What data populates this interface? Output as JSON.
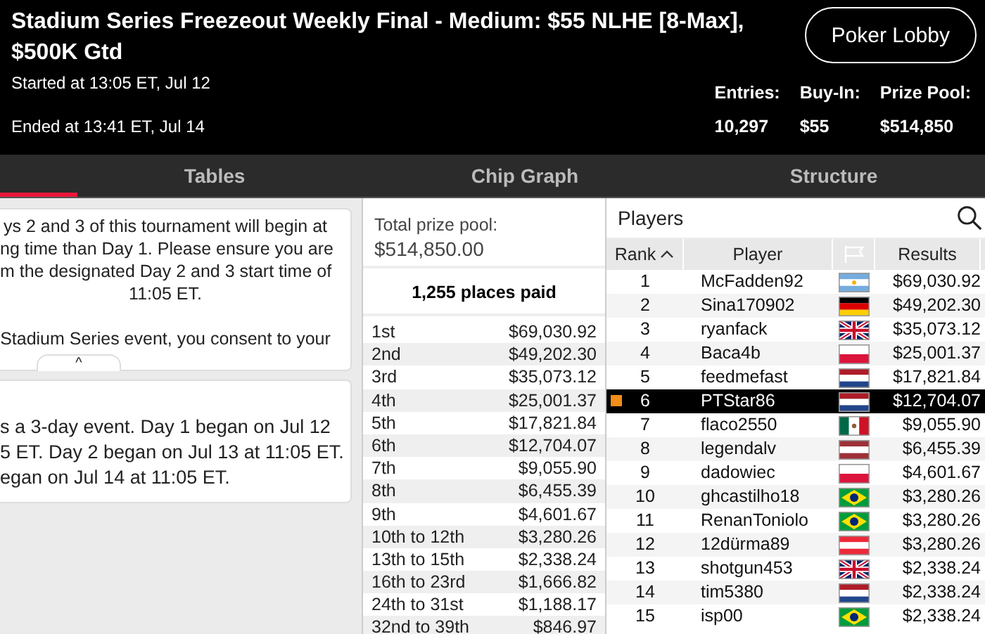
{
  "header": {
    "title": "Stadium Series Freezeout Weekly Final - Medium: $55 NLHE [8-Max], $500K Gtd",
    "started": "Started at 13:05 ET, Jul 12",
    "ended": "Ended at 13:41 ET, Jul 14",
    "lobby_button": "Poker Lobby",
    "stats": [
      {
        "label": "Entries:",
        "value": "10,297"
      },
      {
        "label": "Buy-In:",
        "value": "$55"
      },
      {
        "label": "Prize Pool:",
        "value": "$514,850"
      }
    ]
  },
  "tabs": [
    {
      "label": "Tables",
      "selected": false
    },
    {
      "label": "Chip Graph",
      "selected": false
    },
    {
      "label": "Structure",
      "selected": false
    }
  ],
  "notice": {
    "lines": [
      "ys 2 and 3 of this tournament will begin at",
      "ng time than Day 1. Please ensure you are",
      "m the designated Day 2 and 3 start time of",
      "11:05 ET.",
      "Stadium Series event, you consent to your"
    ],
    "toggle": "^"
  },
  "schedule": {
    "lines": [
      "s a 3-day event. Day 1 began on Jul 12",
      "5 ET. Day 2 began on Jul 13 at 11:05 ET.",
      "egan on Jul 14 at 11:05 ET."
    ]
  },
  "prizes": {
    "total_label": "Total prize pool:",
    "total": "$514,850.00",
    "places_paid": "1,255 places paid",
    "rows": [
      {
        "place": "1st",
        "amount": "$69,030.92"
      },
      {
        "place": "2nd",
        "amount": "$49,202.30"
      },
      {
        "place": "3rd",
        "amount": "$35,073.12"
      },
      {
        "place": "4th",
        "amount": "$25,001.37"
      },
      {
        "place": "5th",
        "amount": "$17,821.84"
      },
      {
        "place": "6th",
        "amount": "$12,704.07"
      },
      {
        "place": "7th",
        "amount": "$9,055.90"
      },
      {
        "place": "8th",
        "amount": "$6,455.39"
      },
      {
        "place": "9th",
        "amount": "$4,601.67"
      },
      {
        "place": "10th to 12th",
        "amount": "$3,280.26"
      },
      {
        "place": "13th to 15th",
        "amount": "$2,338.24"
      },
      {
        "place": "16th to 23rd",
        "amount": "$1,666.82"
      },
      {
        "place": "24th to 31st",
        "amount": "$1,188.17"
      },
      {
        "place": "32nd to 39th",
        "amount": "$846.97"
      }
    ]
  },
  "players": {
    "title": "Players",
    "columns": [
      "Rank",
      "Player",
      "Results"
    ],
    "rows": [
      {
        "rank": "1",
        "name": "McFadden92",
        "kind": "argentina",
        "result": "$69,030.92",
        "selected": false
      },
      {
        "rank": "2",
        "name": "Sina170902",
        "kind": "germany",
        "result": "$49,202.30",
        "selected": false
      },
      {
        "rank": "3",
        "name": "ryanfack",
        "kind": "uk",
        "result": "$35,073.12",
        "selected": false
      },
      {
        "rank": "4",
        "name": "Baca4b",
        "kind": "poland",
        "result": "$25,001.37",
        "selected": false
      },
      {
        "rank": "5",
        "name": "feedmefast",
        "kind": "netherlands",
        "result": "$17,821.84",
        "selected": false
      },
      {
        "rank": "6",
        "name": "PTStar86",
        "kind": "netherlands",
        "result": "$12,704.07",
        "selected": true
      },
      {
        "rank": "7",
        "name": "flaco2550",
        "kind": "mexico",
        "result": "$9,055.90",
        "selected": false
      },
      {
        "rank": "8",
        "name": "legendalv",
        "kind": "latvia",
        "result": "$6,455.39",
        "selected": false
      },
      {
        "rank": "9",
        "name": "dadowiec",
        "kind": "poland",
        "result": "$4,601.67",
        "selected": false
      },
      {
        "rank": "10",
        "name": "ghcastilho18",
        "kind": "brazil",
        "result": "$3,280.26",
        "selected": false
      },
      {
        "rank": "11",
        "name": "RenanToniolo",
        "kind": "brazil",
        "result": "$3,280.26",
        "selected": false
      },
      {
        "rank": "12",
        "name": "12dürma89",
        "kind": "austria",
        "result": "$3,280.26",
        "selected": false
      },
      {
        "rank": "13",
        "name": "shotgun453",
        "kind": "uk",
        "result": "$2,338.24",
        "selected": false
      },
      {
        "rank": "14",
        "name": "tim5380",
        "kind": "netherlands",
        "result": "$2,338.24",
        "selected": false
      },
      {
        "rank": "15",
        "name": "isp00",
        "kind": "brazil",
        "result": "$2,338.24",
        "selected": false
      }
    ]
  }
}
